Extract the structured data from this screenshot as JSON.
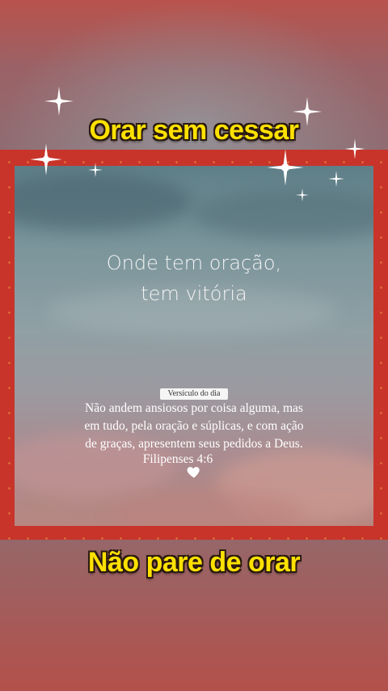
{
  "header": {
    "title": "Orar sem cessar"
  },
  "image": {
    "quote_line1": "Onde tem oração,",
    "quote_line2": "tem vitória",
    "verse_badge": "Versículo do dia",
    "verse_line1": "Não andem ansiosos por coisa alguma, mas",
    "verse_line2": "em tudo, pela oração e súplicas, e com ação",
    "verse_line3": "de graças, apresentem seus pedidos a Deus.",
    "verse_reference": "Filipenses 4:6",
    "heart_icon": "white-heart-icon"
  },
  "footer": {
    "title": "Não pare de orar"
  },
  "colors": {
    "title_text": "#ffe100",
    "frame": "#c8342a",
    "title_outline": "#2a1a10"
  }
}
